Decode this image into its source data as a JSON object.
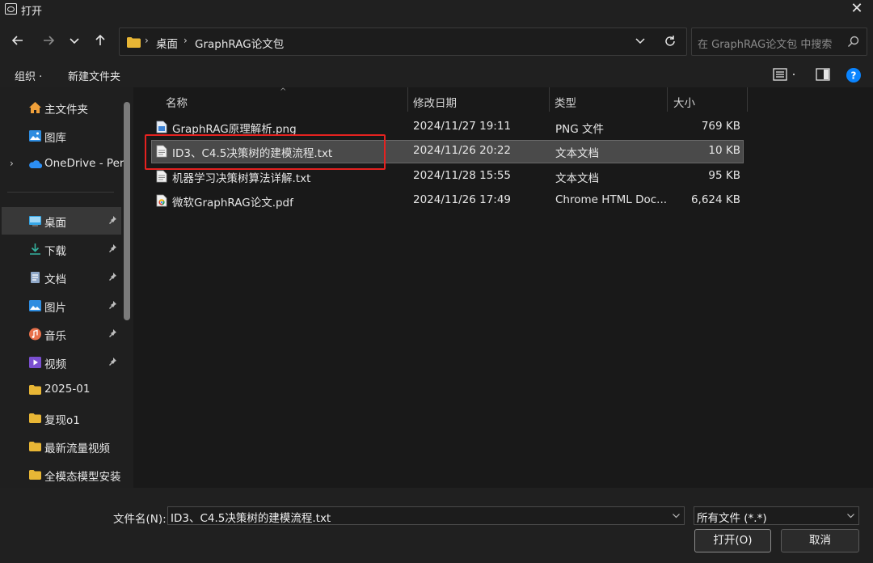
{
  "window": {
    "title": "打开",
    "close_glyph": "✕"
  },
  "nav": {
    "breadcrumb": [
      "桌面",
      "GraphRAG论文包"
    ],
    "search_placeholder": "在 GraphRAG论文包 中搜索"
  },
  "commands": {
    "organize": "组织 ·",
    "new_folder": "新建文件夹"
  },
  "sidebar": {
    "items": [
      {
        "label": "主文件夹",
        "icon": "home-icon"
      },
      {
        "label": "图库",
        "icon": "gallery-icon"
      },
      {
        "label": "OneDrive - Per",
        "icon": "onedrive-cloud-icon"
      },
      {
        "label": "桌面",
        "icon": "desktop-icon",
        "pinned": true,
        "selected": true
      },
      {
        "label": "下载",
        "icon": "download-icon",
        "pinned": true
      },
      {
        "label": "文档",
        "icon": "document-icon",
        "pinned": true
      },
      {
        "label": "图片",
        "icon": "pictures-icon",
        "pinned": true
      },
      {
        "label": "音乐",
        "icon": "music-icon",
        "pinned": true
      },
      {
        "label": "视频",
        "icon": "video-icon",
        "pinned": true
      },
      {
        "label": "2025-01",
        "icon": "folder-icon"
      },
      {
        "label": "复现o1",
        "icon": "folder-icon"
      },
      {
        "label": "最新流量视频",
        "icon": "folder-icon"
      },
      {
        "label": "全模态模型安装",
        "icon": "folder-icon"
      }
    ]
  },
  "files": {
    "columns": [
      "名称",
      "修改日期",
      "类型",
      "大小"
    ],
    "rows": [
      {
        "name": "GraphRAG原理解析.png",
        "date": "2024/11/27 19:11",
        "type": "PNG 文件",
        "size": "769 KB",
        "icon": "png-file-icon"
      },
      {
        "name": "ID3、C4.5决策树的建模流程.txt",
        "date": "2024/11/26 20:22",
        "type": "文本文档",
        "size": "10 KB",
        "icon": "txt-file-icon",
        "selected": true
      },
      {
        "name": "机器学习决策树算法详解.txt",
        "date": "2024/11/28 15:55",
        "type": "文本文档",
        "size": "95 KB",
        "icon": "txt-file-icon"
      },
      {
        "name": "微软GraphRAG论文.pdf",
        "date": "2024/11/26 17:49",
        "type": "Chrome HTML Doc...",
        "size": "6,624 KB",
        "icon": "chrome-pdf-icon"
      }
    ]
  },
  "bottom": {
    "filename_label": "文件名(N):",
    "filename_value": "ID3、C4.5决策树的建模流程.txt",
    "filter_value": "所有文件 (*.*)",
    "open_label": "打开(O)",
    "cancel_label": "取消"
  },
  "colors": {
    "highlight": "#e52220",
    "folder": "#e8b635",
    "accent": "#0a84ff"
  }
}
